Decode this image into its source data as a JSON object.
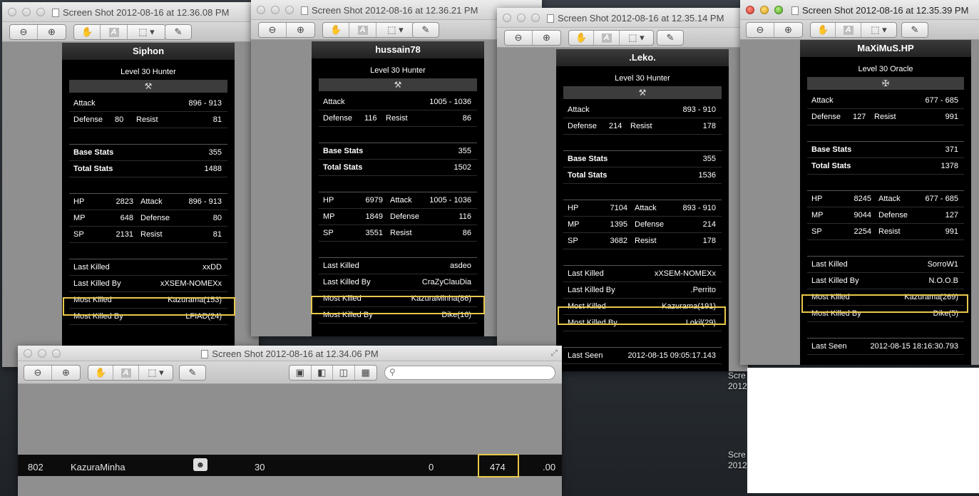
{
  "windows": [
    {
      "title": "Screen Shot 2012-08-16 at 12.36.08 PM"
    },
    {
      "title": "Screen Shot 2012-08-16 at 12.36.21 PM"
    },
    {
      "title": "Screen Shot 2012-08-16 at 12.35.14 PM"
    },
    {
      "title": "Screen Shot 2012-08-16 at 12.35.39 PM"
    },
    {
      "title": "Screen Shot 2012-08-16 at 12.34.06 PM"
    }
  ],
  "labels": {
    "attack": "Attack",
    "defense": "Defense",
    "resist": "Resist",
    "base_stats": "Base Stats",
    "total_stats": "Total Stats",
    "hp": "HP",
    "mp": "MP",
    "sp": "SP",
    "last_killed": "Last Killed",
    "last_killed_by": "Last Killed By",
    "most_killed": "Most Killed",
    "most_killed_by": "Most Killed By",
    "last_seen": "Last Seen"
  },
  "players": [
    {
      "name": "Siphon",
      "level": "Level 30 Hunter",
      "icon": "⚒",
      "attack": "896 - 913",
      "defense": "80",
      "resist": "81",
      "base_stats": "355",
      "total_stats": "1488",
      "hp": "2823",
      "mp": "648",
      "sp": "2131",
      "last_killed": "xxDD",
      "last_killed_by": "xXSEM-NOMEXx",
      "most_killed": "Kazurama(153)",
      "most_killed_by": "LFIAD(24)"
    },
    {
      "name": "hussain78",
      "level": "Level 30 Hunter",
      "icon": "⚒",
      "attack": "1005 - 1036",
      "defense": "116",
      "resist": "86",
      "base_stats": "355",
      "total_stats": "1502",
      "hp": "6979",
      "mp": "1849",
      "sp": "3551",
      "last_killed": "asdeo",
      "last_killed_by": "CraZyClauDia",
      "most_killed": "KazuraMinha(86)",
      "most_killed_by": "Dike(16)"
    },
    {
      "name": ".Leko.",
      "level": "Level 30 Hunter",
      "icon": "⚒",
      "attack": "893 - 910",
      "defense": "214",
      "resist": "178",
      "base_stats": "355",
      "total_stats": "1536",
      "hp": "7104",
      "mp": "1395",
      "sp": "3682",
      "last_killed": "xXSEM-NOMEXx",
      "last_killed_by": ".Perrito",
      "most_killed": "Kazurama(191)",
      "most_killed_by": "Lokil(29)",
      "last_seen": "2012-08-15 09:05:17.143"
    },
    {
      "name": "MaXiMuS.HP",
      "level": "Level 30 Oracle",
      "icon": "✠",
      "attack": "677 - 685",
      "defense": "127",
      "resist": "991",
      "base_stats": "371",
      "total_stats": "1378",
      "hp": "8245",
      "mp": "9044",
      "sp": "2254",
      "last_killed": "SorroW1",
      "last_killed_by": "N.O.O.B",
      "most_killed": "Kazurama(269)",
      "most_killed_by": "Dike(5)",
      "last_seen": "2012-08-15 18:16:30.793"
    }
  ],
  "ranking_row": {
    "rank": "802",
    "name": "KazuraMinha",
    "level": "30",
    "value1": "0",
    "value2": "474",
    "value3": ".00"
  },
  "desktop_labels": [
    "Scre",
    "2012",
    "Scre",
    "2012"
  ]
}
